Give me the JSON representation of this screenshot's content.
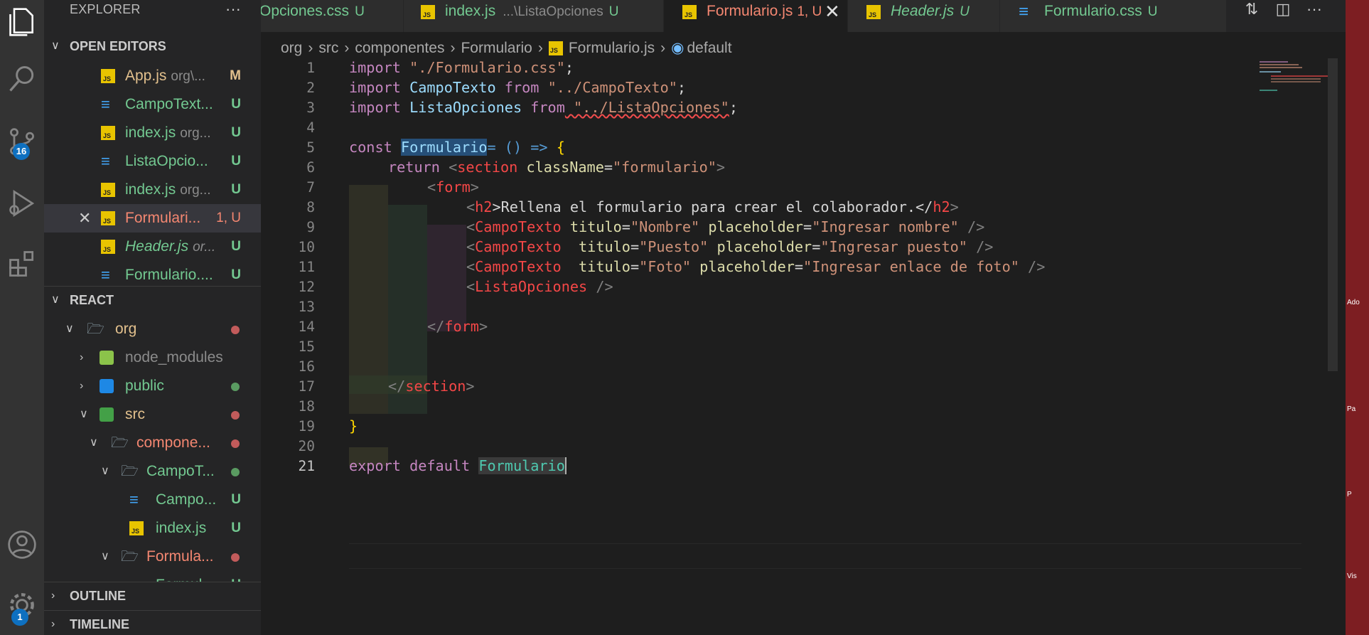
{
  "activity": {
    "source_control_badge": "16",
    "settings_badge": "1"
  },
  "explorer": {
    "title": "EXPLORER",
    "more": "···",
    "open_editors_header": "OPEN EDITORS",
    "open_editors": [
      {
        "name": "App.js",
        "desc": "org\\...",
        "status": "M",
        "type": "js"
      },
      {
        "name": "CampoText...",
        "desc": "",
        "status": "U",
        "type": "css"
      },
      {
        "name": "index.js",
        "desc": "org...",
        "status": "U",
        "type": "js"
      },
      {
        "name": "ListaOpcio...",
        "desc": "",
        "status": "U",
        "type": "css"
      },
      {
        "name": "index.js",
        "desc": "org...",
        "status": "U",
        "type": "js"
      },
      {
        "name": "Formulari...",
        "desc": "",
        "status": "1, U",
        "type": "js"
      },
      {
        "name": "Header.js",
        "desc": "or...",
        "status": "U",
        "type": "js"
      },
      {
        "name": "Formulario....",
        "desc": "",
        "status": "U",
        "type": "css"
      }
    ],
    "react_header": "REACT",
    "tree": [
      {
        "name": "org",
        "kind": "folder"
      },
      {
        "name": "node_modules",
        "kind": "folder"
      },
      {
        "name": "public",
        "kind": "folder"
      },
      {
        "name": "src",
        "kind": "folder"
      },
      {
        "name": "compone...",
        "kind": "folder"
      },
      {
        "name": "CampoT...",
        "kind": "folder"
      },
      {
        "name": "Campo...",
        "kind": "css",
        "status": "U"
      },
      {
        "name": "index.js",
        "kind": "js",
        "status": "U"
      },
      {
        "name": "Formula...",
        "kind": "folder"
      },
      {
        "name": "Formul...",
        "kind": "css",
        "status": "U"
      }
    ],
    "outline_header": "OUTLINE",
    "timeline_header": "TIMELINE"
  },
  "tabs": [
    {
      "name": "Opciones.css",
      "status": "U"
    },
    {
      "name": "index.js",
      "desc": "...\\ListaOpciones",
      "status": "U"
    },
    {
      "name": "Formulario.js",
      "status": "1, U"
    },
    {
      "name": "Header.js",
      "status": "U"
    },
    {
      "name": "Formulario.css",
      "status": "U"
    }
  ],
  "breadcrumb": [
    "org",
    "src",
    "componentes",
    "Formulario",
    "Formulario.js",
    "default"
  ],
  "line_numbers": [
    "1",
    "2",
    "3",
    "4",
    "5",
    "6",
    "7",
    "8",
    "9",
    "10",
    "11",
    "12",
    "13",
    "14",
    "15",
    "16",
    "17",
    "18",
    "19",
    "20",
    "21"
  ],
  "code": {
    "l1": [
      "import",
      " \"./Formulario.css\"",
      ";"
    ],
    "l2": [
      "import",
      " CampoTexto ",
      "from",
      " \"../CampoTexto\"",
      ";"
    ],
    "l3": [
      "import",
      " ListaOpciones ",
      "from",
      " \"../ListaOpciones\"",
      ";"
    ],
    "l5": [
      "const",
      " ",
      "Formulario",
      "= () => ",
      "{"
    ],
    "l6": [
      "return",
      " <",
      "section",
      " className",
      "=",
      "\"formulario\"",
      ">"
    ],
    "l7": [
      "<",
      "form",
      ">"
    ],
    "l8": [
      "<",
      "h2",
      ">Rellena el formulario para crear el colaborador.</",
      "h2",
      ">"
    ],
    "l9": [
      "<",
      "CampoTexto",
      " titulo",
      "=",
      "\"Nombre\"",
      " placeholder",
      "=",
      "\"Ingresar nombre\"",
      " />"
    ],
    "l10": [
      "<",
      "CampoTexto",
      "  titulo",
      "=",
      "\"Puesto\"",
      " placeholder",
      "=",
      "\"Ingresar puesto\"",
      " />"
    ],
    "l11": [
      "<",
      "CampoTexto",
      "  titulo",
      "=",
      "\"Foto\"",
      " placeholder",
      "=",
      "\"Ingresar enlace de foto\"",
      " />"
    ],
    "l12": [
      "<",
      "ListaOpciones",
      " />"
    ],
    "l14": [
      "</",
      "form",
      ">"
    ],
    "l17": [
      "</",
      "section",
      ">"
    ],
    "l19": [
      "}"
    ],
    "l21": [
      "export",
      " default ",
      "Formulario"
    ]
  },
  "desktop": {
    "labels": [
      "Ado",
      "Pa",
      "P",
      "Vis"
    ]
  },
  "colors": {
    "editor_bg": "#1e1e1e",
    "sidebar_bg": "#252526",
    "activity_bg": "#333333",
    "badge": "#0e70c0",
    "untracked": "#73c991",
    "modified": "#e2c08d",
    "error": "#f48771"
  }
}
